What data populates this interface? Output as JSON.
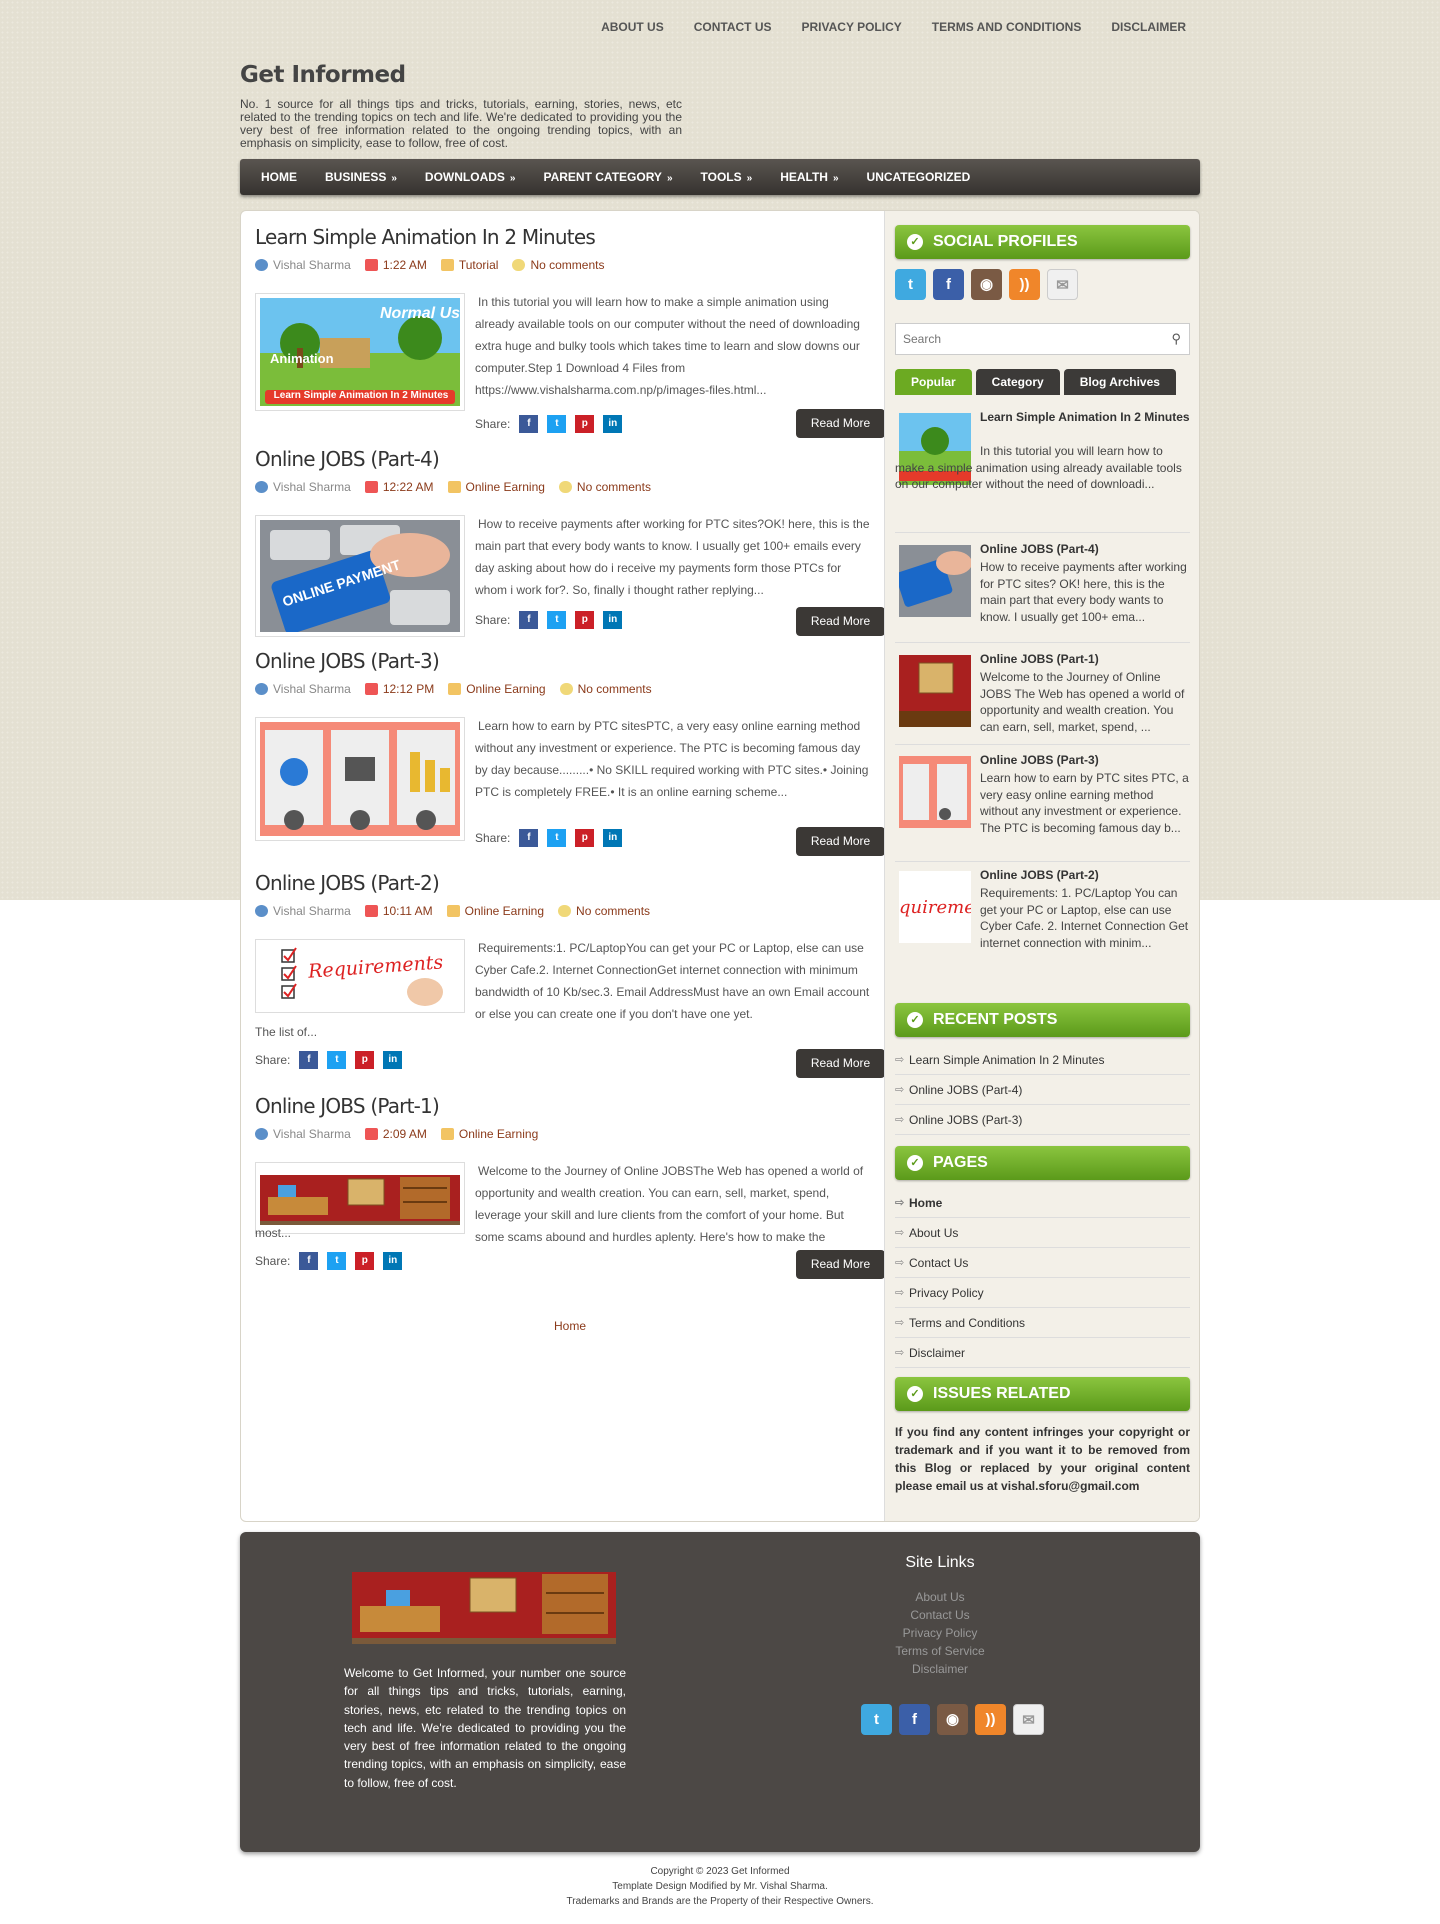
{
  "top_links": [
    "ABOUT US",
    "CONTACT US",
    "PRIVACY POLICY",
    "TERMS AND CONDITIONS",
    "DISCLAIMER"
  ],
  "site": {
    "title": "Get Informed",
    "description": "No. 1 source for all things tips and tricks, tutorials, earning, stories, news, etc related to the trending topics on tech and life. We're dedicated to providing you the very best of free information related to the ongoing trending topics, with an emphasis on simplicity, ease to follow, free of cost."
  },
  "nav": [
    {
      "label": "HOME",
      "arrow": ""
    },
    {
      "label": "BUSINESS",
      "arrow": "»"
    },
    {
      "label": "DOWNLOADS",
      "arrow": "»"
    },
    {
      "label": "PARENT CATEGORY",
      "arrow": "»"
    },
    {
      "label": "TOOLS",
      "arrow": "»"
    },
    {
      "label": "HEALTH",
      "arrow": "»"
    },
    {
      "label": "UNCATEGORIZED",
      "arrow": ""
    }
  ],
  "posts": [
    {
      "title": "Learn Simple Animation In 2 Minutes",
      "author": "Vishal Sharma",
      "time": "1:22 AM",
      "category": "Tutorial",
      "comments": "No comments",
      "excerpt": "In this tutorial you will learn how to make a simple animation using already available tools on our computer without the need of downloading extra huge and bulky tools which takes time to learn and slow downs our computer.Step 1 Download 4 Files from https://www.vishalsharma.com.np/p/images-files.html...",
      "thumb_caption": "Learn Simple Animation In 2 Minutes"
    },
    {
      "title": "Online JOBS (Part-4)",
      "author": "Vishal Sharma",
      "time": "12:22 AM",
      "category": "Online Earning",
      "comments": "No comments",
      "excerpt": "How to receive payments after working for PTC sites?OK! here, this is the main part that every body wants to know. I usually get 100+ emails every day asking about how do i receive my payments form those PTCs for whom i work for?. So, finally i thought rather replying...",
      "thumb_caption": "ONLINE PAYMENT"
    },
    {
      "title": "Online JOBS (Part-3)",
      "author": "Vishal Sharma",
      "time": "12:12 PM",
      "category": "Online Earning",
      "comments": "No comments",
      "excerpt": "Learn how to earn by PTC sitesPTC, a very easy online earning method without any investment or experience. The PTC is becoming famous day by day because.........• No SKILL required working with PTC sites.• Joining PTC is completely FREE.• It is an online earning scheme...",
      "thumb_caption": ""
    },
    {
      "title": "Online JOBS (Part-2)",
      "author": "Vishal Sharma",
      "time": "10:11 AM",
      "category": "Online Earning",
      "comments": "No comments",
      "excerpt": "Requirements:1. PC/LaptopYou can get your PC or Laptop, else can use Cyber Cafe.2. Internet ConnectionGet internet connection with minimum bandwidth of 10 Kb/sec.3. Email AddressMust have an own Email account or else you can create one if you don't have one yet.",
      "excerpt_more": "The list of...",
      "thumb_caption": "Requirements"
    },
    {
      "title": "Online JOBS (Part-1)",
      "author": "Vishal Sharma",
      "time": "2:09 AM",
      "category": "Online Earning",
      "comments": "",
      "excerpt": "Welcome to the Journey of Online JOBSThe Web has opened a world of opportunity and wealth creation. You can earn, sell, market, spend, leverage your skill and lure clients from the comfort of your home. But some scams abound and hurdles aplenty. Here's how to make the",
      "excerpt_more": "most...",
      "thumb_caption": ""
    }
  ],
  "share_label": "Share:",
  "read_more": "Read More",
  "home_link": "Home",
  "sidebar": {
    "social_title": "SOCIAL PROFILES",
    "search_placeholder": "Search",
    "tabs": [
      "Popular",
      "Category",
      "Blog Archives"
    ],
    "popular": [
      {
        "title": "Learn Simple Animation In 2 Minutes",
        "text": "In this tutorial you will learn how to make a simple animation using already available tools on our computer without the need of downloadi..."
      },
      {
        "title": "Online JOBS (Part-4)",
        "text": "How to receive payments after working for PTC sites? OK! here, this is the main part that every body wants to know. I usually get 100+ ema..."
      },
      {
        "title": "Online JOBS (Part-1)",
        "text": "Welcome to the Journey of Online JOBS The Web has opened a world of opportunity and wealth creation. You can earn, sell, market, spend, ..."
      },
      {
        "title": "Online JOBS (Part-3)",
        "text": "Learn how to earn by PTC sites PTC, a very easy online earning method without any investment or experience. The PTC is becoming famous day b..."
      },
      {
        "title": "Online JOBS (Part-2)",
        "text": "Requirements: 1. PC/Laptop You can get your PC or Laptop, else can use Cyber Cafe. 2. Internet Connection Get internet connection with minim..."
      }
    ],
    "recent_title": "RECENT POSTS",
    "recent": [
      "Learn Simple Animation In 2 Minutes",
      "Online JOBS (Part-4)",
      "Online JOBS (Part-3)"
    ],
    "pages_title": "PAGES",
    "pages": [
      "Home",
      "About Us",
      "Contact Us",
      "Privacy Policy",
      "Terms and Conditions",
      "Disclaimer"
    ],
    "issues_title": "ISSUES RELATED",
    "issues_text": "If you find any content infringes your copyright or trademark and if you want it to be removed from this Blog or replaced by your original content please email us at vishal.sforu@gmail.com"
  },
  "footer": {
    "desc": "Welcome to Get Informed, your number one source for all things tips and tricks, tutorials, earning, stories, news, etc related to the trending topics on tech and life. We're dedicated to providing you the very best of free information related to the ongoing trending topics, with an emphasis on simplicity, ease to follow, free of cost.",
    "links_title": "Site Links",
    "links": [
      "About Us",
      "Contact Us",
      "Privacy Policy",
      "Terms of Service",
      "Disclaimer"
    ],
    "copyright": [
      "Copyright © 2023 Get Informed",
      "Template Design Modified by Mr. Vishal Sharma.",
      "Trademarks and Brands are the Property of their Respective Owners."
    ]
  },
  "colors": {
    "accent_green": "#6caa22",
    "dark": "#3b3835",
    "link_brown": "#8b3a1a"
  },
  "icons": {
    "social": [
      "twitter-icon",
      "facebook-icon",
      "instagram-icon",
      "rss-icon",
      "mail-icon"
    ]
  }
}
